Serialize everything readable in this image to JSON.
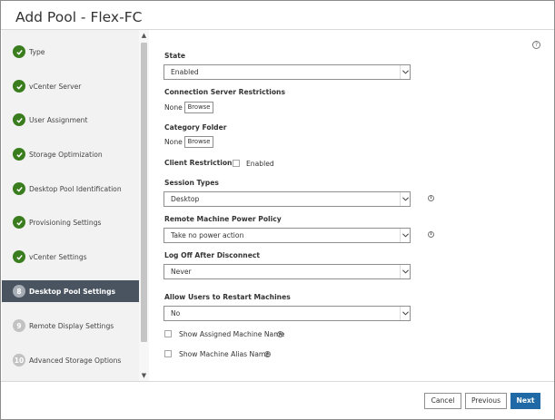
{
  "dialog": {
    "title": "Add Pool - Flex-FC"
  },
  "sidebar": {
    "steps": [
      {
        "label": "Type",
        "status": "done"
      },
      {
        "label": "vCenter Server",
        "status": "done"
      },
      {
        "label": "User Assignment",
        "status": "done"
      },
      {
        "label": "Storage Optimization",
        "status": "done"
      },
      {
        "label": "Desktop Pool Identification",
        "status": "done"
      },
      {
        "label": "Provisioning Settings",
        "status": "done"
      },
      {
        "label": "vCenter Settings",
        "status": "done"
      },
      {
        "label": "Desktop Pool Settings",
        "status": "active",
        "number": "8"
      },
      {
        "label": "Remote Display Settings",
        "status": "pending",
        "number": "9"
      },
      {
        "label": "Advanced Storage Options",
        "status": "pending",
        "number": "10"
      }
    ],
    "scroll_up_glyph": "▲",
    "scroll_down_glyph": "▼"
  },
  "form": {
    "help_glyph": "?",
    "info_glyph": "i",
    "state": {
      "label": "State",
      "value": "Enabled"
    },
    "connection_server_restrictions": {
      "label": "Connection Server Restrictions",
      "value": "None",
      "button": "Browse"
    },
    "category_folder": {
      "label": "Category Folder",
      "value": "None",
      "button": "Browse"
    },
    "client_restrictions": {
      "label": "Client Restrictions",
      "checkbox_label": "Enabled",
      "checked": false
    },
    "session_types": {
      "label": "Session Types",
      "value": "Desktop"
    },
    "remote_machine_power_policy": {
      "label": "Remote Machine Power Policy",
      "value": "Take no power action"
    },
    "log_off_after_disconnect": {
      "label": "Log Off After Disconnect",
      "value": "Never"
    },
    "allow_users_restart": {
      "label": "Allow Users to Restart Machines",
      "value": "No"
    },
    "show_assigned_machine_name": {
      "label": "Show Assigned Machine Name",
      "checked": false
    },
    "show_machine_alias_name": {
      "label": "Show Machine Alias Name",
      "checked": false
    }
  },
  "footer": {
    "cancel_label": "Cancel",
    "previous_label": "Previous",
    "next_label": "Next"
  },
  "colors": {
    "done_badge": "#3a7d1e",
    "active_step_bg": "#4a5461",
    "primary_button": "#1f6aa6"
  }
}
